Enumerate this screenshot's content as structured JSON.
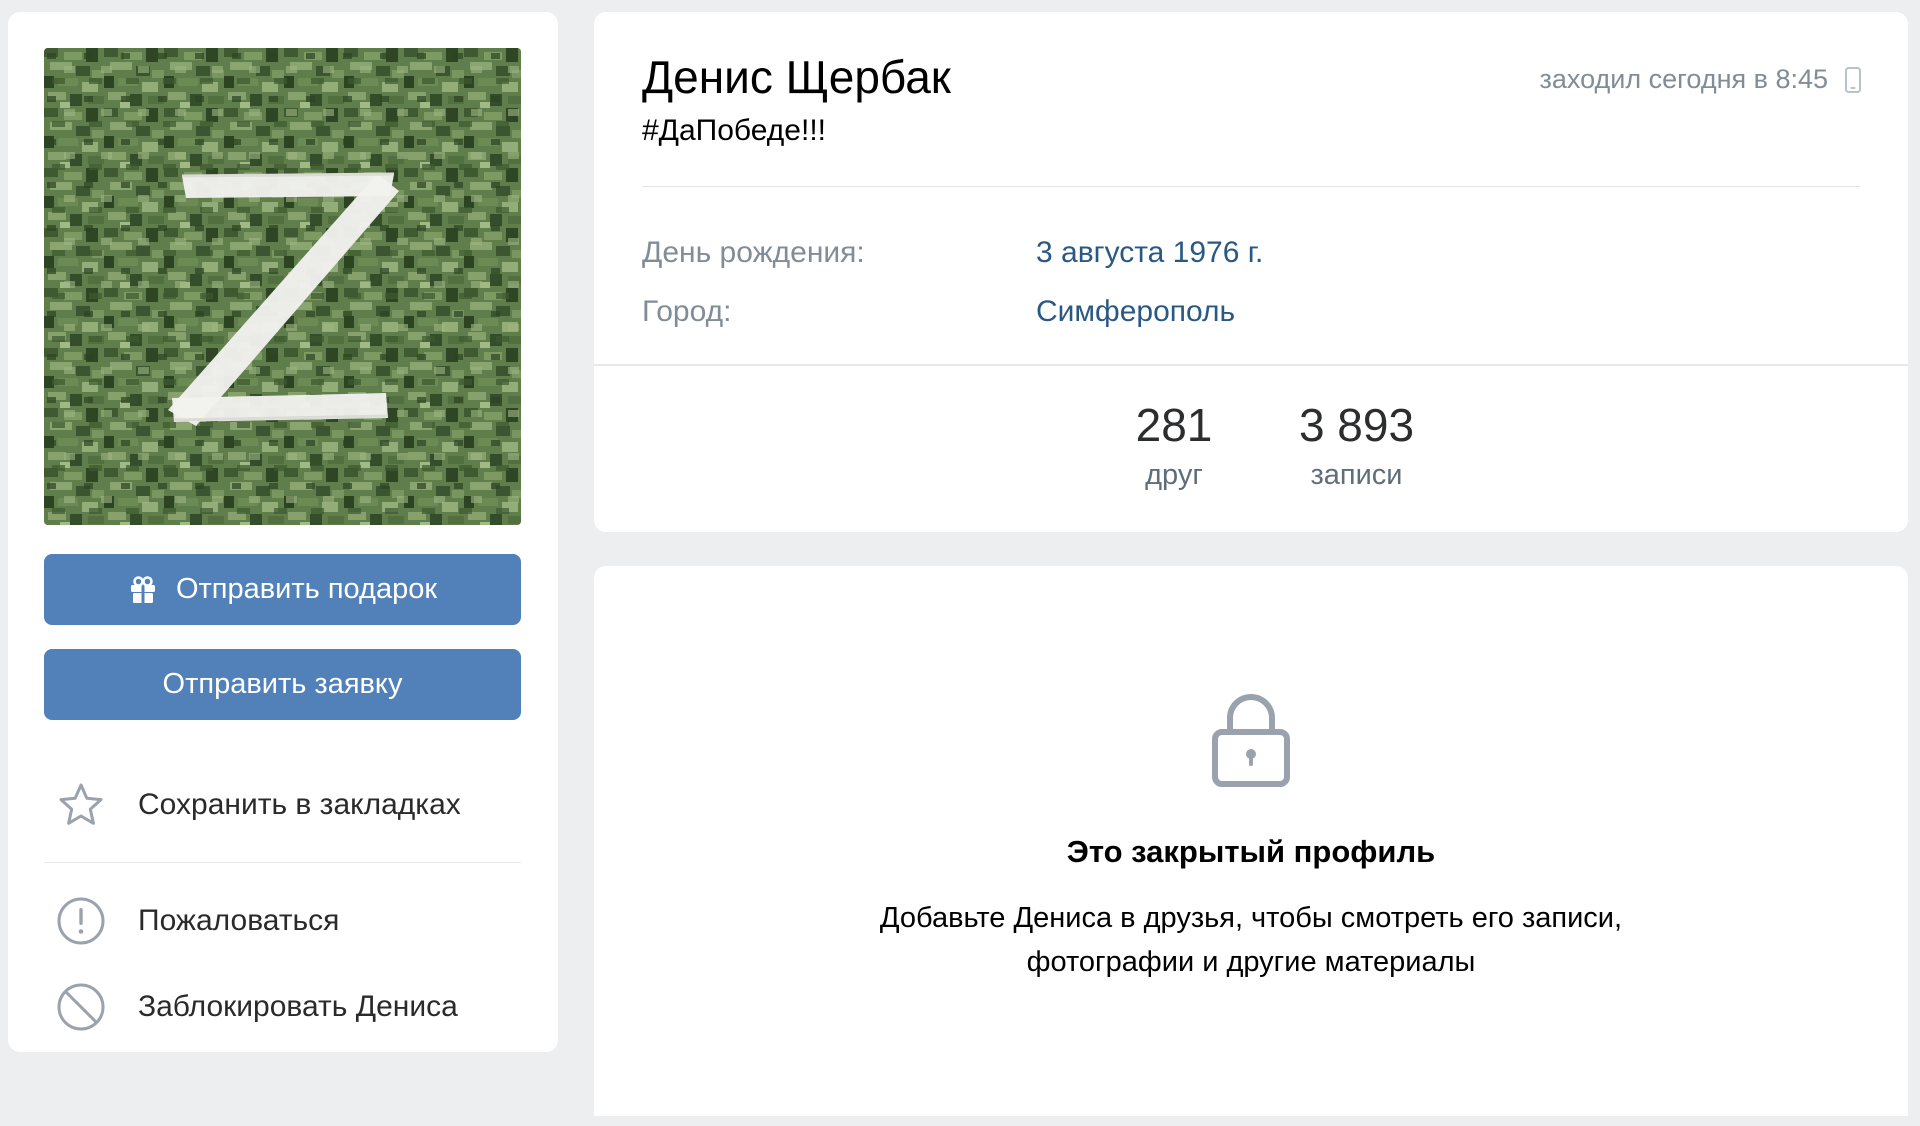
{
  "profile": {
    "name": "Денис Щербак",
    "status": "#ДаПобеде!!!",
    "online": "заходил сегодня в 8:45",
    "online_icon": "mobile-phone-icon",
    "avatar_description": "white letter Z on green camouflage",
    "info": {
      "birthday_label": "День рождения:",
      "birthday_value": "3 августа 1976 г.",
      "city_label": "Город:",
      "city_value": "Симферополь"
    },
    "counters": {
      "friends_count": "281",
      "friends_label": "друг",
      "posts_count": "3 893",
      "posts_label": "записи"
    }
  },
  "actions": {
    "send_gift": "Отправить подарок",
    "send_request": "Отправить заявку",
    "bookmark": "Сохранить в закладках",
    "report": "Пожаловаться",
    "block": "Заблокировать Дениса"
  },
  "private": {
    "title": "Это закрытый профиль",
    "desc_line1": "Добавьте Дениса в друзья, чтобы смотреть его записи,",
    "desc_line2": "фотографии и другие материалы"
  },
  "colors": {
    "background": "#edeef0",
    "card": "#ffffff",
    "button": "#5181b8",
    "link": "#2a5885",
    "secondary_text": "#818c99",
    "icon": "#99a2ad"
  }
}
